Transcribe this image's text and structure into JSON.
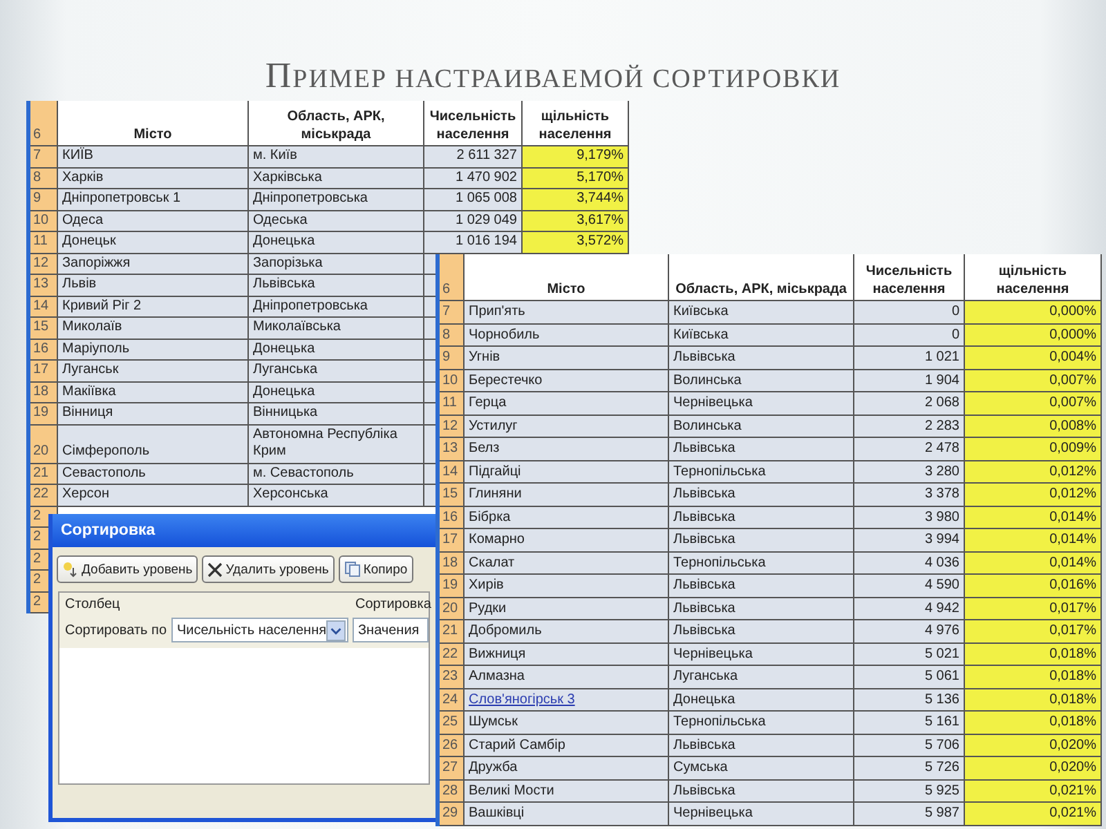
{
  "slide": {
    "title": "ПРИМЕР НАСТРАИВАЕМОЙ СОРТИРОВКИ"
  },
  "sheet_before": {
    "columns": [
      "6",
      "Місто",
      "Область, АРК, міськрада",
      "Чисельність населення",
      "щільність населення"
    ],
    "rows": [
      {
        "num": "7",
        "city": "КИЇВ",
        "region": "м. Київ",
        "population": "2 611 327",
        "density": "9,179%"
      },
      {
        "num": "8",
        "city": "Харків",
        "region": "Харківська",
        "population": "1 470 902",
        "density": "5,170%"
      },
      {
        "num": "9",
        "city": "Дніпропетровськ 1",
        "region": "Дніпропетровська",
        "population": "1 065 008",
        "density": "3,744%"
      },
      {
        "num": "10",
        "city": "Одеса",
        "region": "Одеська",
        "population": "1 029 049",
        "density": "3,617%"
      },
      {
        "num": "11",
        "city": "Донецьк",
        "region": "Донецька",
        "population": "1 016 194",
        "density": "3,572%"
      },
      {
        "num": "12",
        "city": "Запоріжжя",
        "region": "Запорізька"
      },
      {
        "num": "13",
        "city": "Львів",
        "region": "Львівська"
      },
      {
        "num": "14",
        "city": "Кривий Ріг 2",
        "region": "Дніпропетровська"
      },
      {
        "num": "15",
        "city": "Миколаїв",
        "region": "Миколаївська"
      },
      {
        "num": "16",
        "city": "Маріуполь",
        "region": "Донецька"
      },
      {
        "num": "17",
        "city": "Луганськ",
        "region": "Луганська"
      },
      {
        "num": "18",
        "city": "Макіївка",
        "region": "Донецька"
      },
      {
        "num": "19",
        "city": "Вінниця",
        "region": "Вінницька"
      },
      {
        "num": "20",
        "city": "Сімферополь",
        "region": "Автономна Республіка Крим"
      },
      {
        "num": "21",
        "city": "Севастополь",
        "region": "м. Севастополь"
      },
      {
        "num": "22",
        "city": "Херсон",
        "region": "Херсонська"
      },
      {
        "num": "2"
      },
      {
        "num": "2"
      },
      {
        "num": "2"
      },
      {
        "num": "2"
      },
      {
        "num": "2"
      }
    ]
  },
  "sort_dialog": {
    "title": "Сортировка",
    "buttons": [
      "Добавить уровень",
      "Удалить уровень",
      "Копиро"
    ],
    "grid_headers": [
      "Столбец",
      "Сортировка"
    ],
    "level": {
      "label": "Сортировать по",
      "column": "Чисельність населення",
      "sort_on": "Значения"
    }
  },
  "sheet_after": {
    "columns": [
      "6",
      "Місто",
      "Область, АРК, міськрада",
      "Чисельність населення",
      "щільність населення"
    ],
    "rows": [
      {
        "num": "7",
        "city": "Прип'ять",
        "region": "Київська",
        "population": "0",
        "density": "0,000%",
        "link": false
      },
      {
        "num": "8",
        "city": "Чорнобиль",
        "region": "Київська",
        "population": "0",
        "density": "0,000%",
        "link": false
      },
      {
        "num": "9",
        "city": "Угнів",
        "region": "Львівська",
        "population": "1 021",
        "density": "0,004%",
        "link": false
      },
      {
        "num": "10",
        "city": "Берестечко",
        "region": "Волинська",
        "population": "1 904",
        "density": "0,007%",
        "link": false
      },
      {
        "num": "11",
        "city": "Герца",
        "region": "Чернівецька",
        "population": "2 068",
        "density": "0,007%",
        "link": false
      },
      {
        "num": "12",
        "city": "Устилуг",
        "region": "Волинська",
        "population": "2 283",
        "density": "0,008%",
        "link": false
      },
      {
        "num": "13",
        "city": "Белз",
        "region": "Львівська",
        "population": "2 478",
        "density": "0,009%",
        "link": false
      },
      {
        "num": "14",
        "city": "Підгайці",
        "region": "Тернопільська",
        "population": "3 280",
        "density": "0,012%",
        "link": false
      },
      {
        "num": "15",
        "city": "Глиняни",
        "region": "Львівська",
        "population": "3 378",
        "density": "0,012%",
        "link": false
      },
      {
        "num": "16",
        "city": "Бібрка",
        "region": "Львівська",
        "population": "3 980",
        "density": "0,014%",
        "link": false
      },
      {
        "num": "17",
        "city": "Комарно",
        "region": "Львівська",
        "population": "3 994",
        "density": "0,014%",
        "link": false
      },
      {
        "num": "18",
        "city": "Скалат",
        "region": "Тернопільська",
        "population": "4 036",
        "density": "0,014%",
        "link": false
      },
      {
        "num": "19",
        "city": "Хирів",
        "region": "Львівська",
        "population": "4 590",
        "density": "0,016%",
        "link": false
      },
      {
        "num": "20",
        "city": "Рудки",
        "region": "Львівська",
        "population": "4 942",
        "density": "0,017%",
        "link": false
      },
      {
        "num": "21",
        "city": "Добромиль",
        "region": "Львівська",
        "population": "4 976",
        "density": "0,017%",
        "link": false
      },
      {
        "num": "22",
        "city": "Вижниця",
        "region": "Чернівецька",
        "population": "5 021",
        "density": "0,018%",
        "link": false
      },
      {
        "num": "23",
        "city": "Алмазна",
        "region": "Луганська",
        "population": "5 061",
        "density": "0,018%",
        "link": false
      },
      {
        "num": "24",
        "city": "Слов'яногірськ 3",
        "region": "Донецька",
        "population": "5 136",
        "density": "0,018%",
        "link": true
      },
      {
        "num": "25",
        "city": "Шумськ",
        "region": "Тернопільська",
        "population": "5 161",
        "density": "0,018%",
        "link": false
      },
      {
        "num": "26",
        "city": "Старий Самбір",
        "region": "Львівська",
        "population": "5 706",
        "density": "0,020%",
        "link": false
      },
      {
        "num": "27",
        "city": "Дружба",
        "region": "Сумська",
        "population": "5 726",
        "density": "0,020%",
        "link": false
      },
      {
        "num": "28",
        "city": "Великі Мости",
        "region": "Львівська",
        "population": "5 925",
        "density": "0,021%",
        "link": false
      },
      {
        "num": "29",
        "city": "Вашківці",
        "region": "Чернівецька",
        "population": "5 987",
        "density": "0,021%",
        "link": false
      }
    ]
  }
}
